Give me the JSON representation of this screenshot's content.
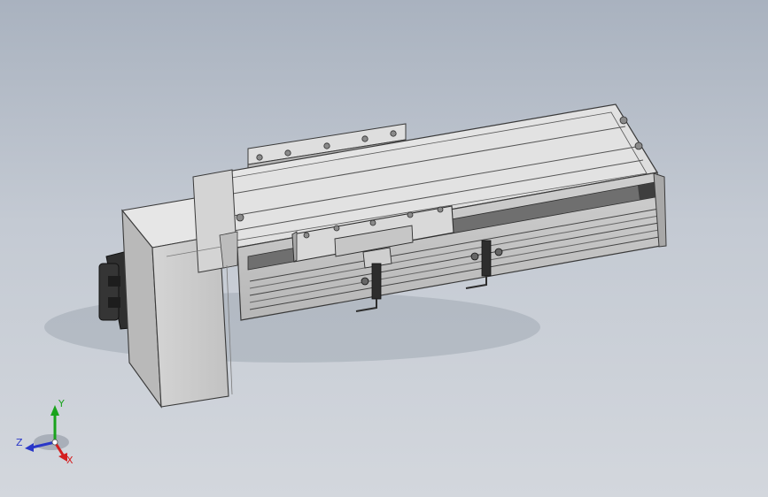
{
  "view": {
    "triad": {
      "x_label": "X",
      "y_label": "Y",
      "z_label": "Z"
    },
    "colors": {
      "background_top": "#a9b2bf",
      "background_bottom": "#d3d7dd",
      "part_light": "#e4e4e4",
      "part_mid": "#c9c9c9",
      "part_dark": "#7d7d7d",
      "edge": "#3a3a3a",
      "motor": "#2f2f2f",
      "axis_x": "#d41f1f",
      "axis_y": "#19a31c",
      "axis_z": "#2a37c8"
    },
    "icons": [
      "reference-triad-icon"
    ]
  }
}
